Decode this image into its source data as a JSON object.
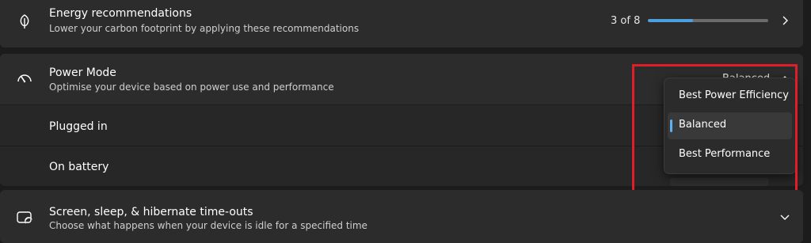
{
  "energy": {
    "title": "Energy recommendations",
    "subtitle": "Lower your carbon footprint by applying these recommendations",
    "progress_text": "3 of 8",
    "progress_value": 0.375,
    "accent": "#4ca0e0",
    "icon": "leaf-icon"
  },
  "power_mode": {
    "title": "Power Mode",
    "subtitle": "Optimise your device based on power use and performance",
    "selected": "Balanced",
    "icon": "gauge-icon",
    "rows": [
      {
        "label": "Plugged in"
      },
      {
        "label": "On battery"
      }
    ],
    "options": [
      {
        "label": "Best Power Efficiency",
        "selected": false
      },
      {
        "label": "Balanced",
        "selected": true
      },
      {
        "label": "Best Performance",
        "selected": false
      }
    ]
  },
  "screen_sleep": {
    "title": "Screen, sleep, & hibernate time-outs",
    "subtitle": "Choose what happens when your device is idle for a specified time",
    "icon": "screen-sleep-icon"
  },
  "highlight_color": "#e01e2a"
}
